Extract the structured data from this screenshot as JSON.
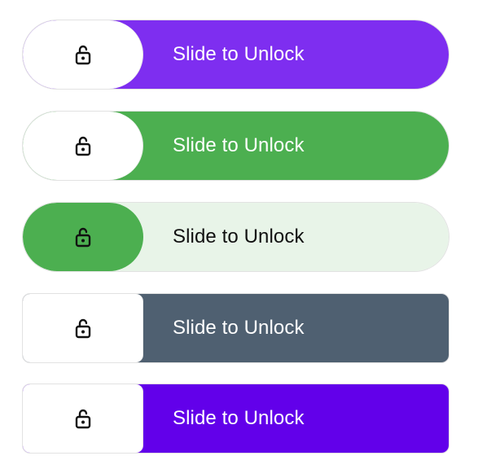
{
  "sliders": [
    {
      "label": "Slide to Unlock",
      "track_color": "#7e2ef0",
      "handle_color": "#ffffff",
      "label_color": "#ffffff",
      "icon": "lock-open-icon",
      "shape": "pill"
    },
    {
      "label": "Slide to Unlock",
      "track_color": "#4caf50",
      "handle_color": "#ffffff",
      "label_color": "#ffffff",
      "icon": "lock-open-icon",
      "shape": "pill"
    },
    {
      "label": "Slide to Unlock",
      "track_color": "#e8f4e8",
      "handle_color": "#4caf50",
      "label_color": "#111111",
      "icon": "lock-open-icon",
      "shape": "pill"
    },
    {
      "label": "Slide to Unlock",
      "track_color": "#4f6071",
      "handle_color": "#ffffff",
      "label_color": "#ffffff",
      "icon": "lock-open-icon",
      "shape": "rounded-rect"
    },
    {
      "label": "Slide to Unlock",
      "track_color": "#6200ea",
      "handle_color": "#ffffff",
      "label_color": "#ffffff",
      "icon": "lock-open-icon",
      "shape": "rounded-rect"
    }
  ]
}
